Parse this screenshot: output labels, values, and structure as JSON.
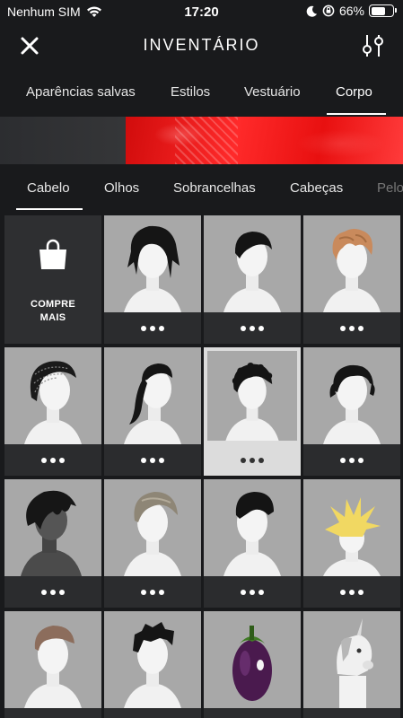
{
  "status_bar": {
    "carrier": "Nenhum SIM",
    "time": "17:20",
    "battery": "66%",
    "battery_level": 0.66,
    "icons": [
      "wifi-icon",
      "moon-icon",
      "orientation-lock-icon",
      "battery-icon"
    ]
  },
  "header": {
    "title": "INVENTÁRIO",
    "close_icon": "close-icon",
    "filter_icon": "sliders-icon"
  },
  "main_tabs": [
    {
      "label": "Aparências salvas",
      "active": false
    },
    {
      "label": "Estilos",
      "active": false
    },
    {
      "label": "Vestuário",
      "active": false
    },
    {
      "label": "Corpo",
      "active": true
    }
  ],
  "sub_tabs": [
    {
      "label": "Cabelo",
      "active": true
    },
    {
      "label": "Olhos",
      "active": false
    },
    {
      "label": "Sobrancelhas",
      "active": false
    },
    {
      "label": "Cabeças",
      "active": false
    },
    {
      "label": "Pelo",
      "active": false
    }
  ],
  "shop_tile": {
    "label_line1": "COMPRE",
    "label_line2": "MAIS",
    "icon": "shopping-bag-icon"
  },
  "items": [
    {
      "name": "shaggy-black-hair",
      "selected": false
    },
    {
      "name": "black-fringe-hair",
      "selected": false
    },
    {
      "name": "wavy-brown-hair",
      "selected": false
    },
    {
      "name": "braided-cornrows-hair",
      "selected": false
    },
    {
      "name": "black-ponytail-hair",
      "selected": false
    },
    {
      "name": "curly-black-hair",
      "selected": true
    },
    {
      "name": "short-black-waves-hair",
      "selected": false
    },
    {
      "name": "messy-black-hair-dark-avatar",
      "selected": false
    },
    {
      "name": "gray-side-swept-hair",
      "selected": false
    },
    {
      "name": "black-undercut-hair",
      "selected": false
    },
    {
      "name": "yellow-spiky-hair",
      "selected": false
    },
    {
      "name": "brown-quiff-hair",
      "selected": false
    },
    {
      "name": "black-spiky-hair",
      "selected": false
    },
    {
      "name": "eggplant-head",
      "selected": false
    },
    {
      "name": "unicorn-head",
      "selected": false
    }
  ],
  "colors": {
    "background": "#191a1c",
    "tile": "#a8a8a8",
    "tile_footer": "#2b2c2e",
    "banner_red": "#e81010"
  }
}
